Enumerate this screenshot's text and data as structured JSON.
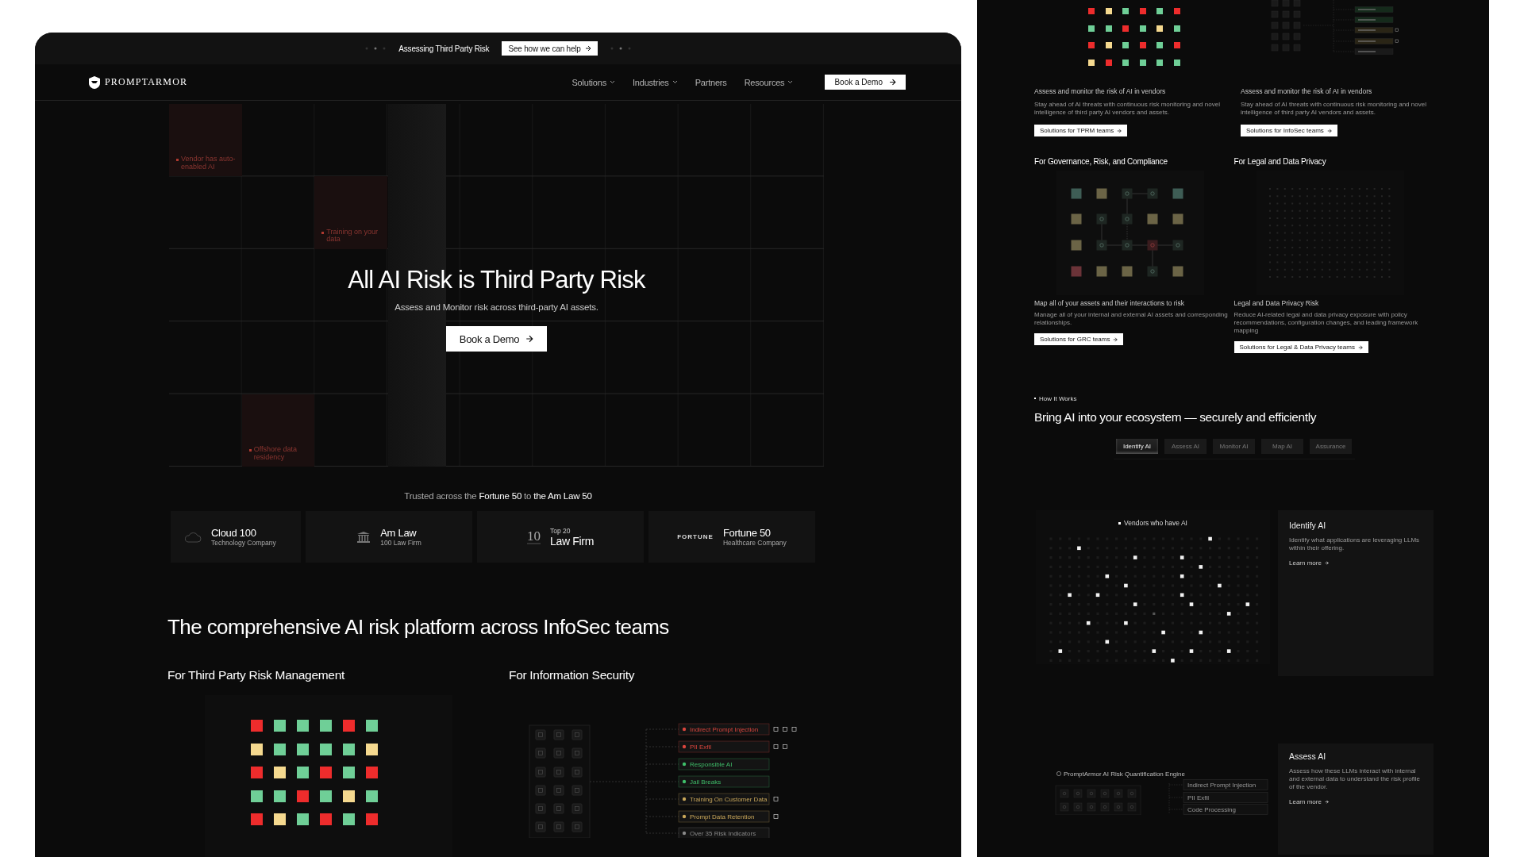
{
  "announcement": {
    "text": "Assessing Third Party Risk",
    "cta": "See how we can help"
  },
  "nav": {
    "logo": "PROMPTARMOR",
    "items": [
      {
        "label": "Solutions",
        "dropdown": true
      },
      {
        "label": "Industries",
        "dropdown": true
      },
      {
        "label": "Partners",
        "dropdown": false
      },
      {
        "label": "Resources",
        "dropdown": true
      }
    ],
    "cta": "Book a Demo"
  },
  "hero": {
    "title": "All AI Risk is Third Party Risk",
    "subtitle": "Assess and Monitor risk across third-party AI assets.",
    "cta": "Book a Demo",
    "risk_tags": [
      "Vendor has auto-enabled AI",
      "Training on your data",
      "Offshore data residency"
    ]
  },
  "trusted": {
    "text": "Trusted across the **Fortune 50** to **the Am Law 50**",
    "logos": [
      {
        "kind": "cloud",
        "title": "Cloud 100",
        "subtitle": "Technology Company"
      },
      {
        "kind": "amlaw",
        "title": "Am Law",
        "subtitle": "100 Law Firm"
      },
      {
        "kind": "ten",
        "mark": "10",
        "eyebrow": "Top 20",
        "title": "Law Firm"
      },
      {
        "kind": "fortune",
        "mark": "FORTUNE",
        "title": "Fortune 50",
        "subtitle": "Healthcare Company"
      }
    ]
  },
  "platform": {
    "title": "The comprehensive AI risk platform across InfoSec teams",
    "columns": [
      {
        "heading": "For Third Party Risk Management",
        "kind": "status_grid"
      },
      {
        "heading": "For Information Security",
        "kind": "risk_flow"
      }
    ],
    "risk_grid": [
      [
        {
          "color": "#ee2c2c"
        },
        {
          "color": "#6fcf97"
        },
        {
          "color": "#6fcf97"
        },
        {
          "color": "#6fcf97"
        },
        {
          "color": "#ee2c2c"
        },
        {
          "color": "#6fcf97"
        }
      ],
      [
        {
          "color": "#f5d98f"
        },
        {
          "color": "#6fcf97"
        },
        {
          "color": "#6fcf97"
        },
        {
          "color": "#6fcf97"
        },
        {
          "color": "#6fcf97"
        },
        {
          "color": "#f5d98f"
        }
      ],
      [
        {
          "color": "#ee2c2c"
        },
        {
          "color": "#f5d98f"
        },
        {
          "color": "#6fcf97"
        },
        {
          "color": "#ee2c2c"
        },
        {
          "color": "#6fcf97"
        },
        {
          "color": "#ee2c2c"
        }
      ],
      [
        {
          "color": "#6fcf97"
        },
        {
          "color": "#6fcf97"
        },
        {
          "color": "#ee2c2c"
        },
        {
          "color": "#6fcf97"
        },
        {
          "color": "#f5d98f"
        },
        {
          "color": "#6fcf97"
        }
      ],
      [
        {
          "color": "#ee2c2c"
        },
        {
          "color": "#f5d98f"
        },
        {
          "color": "#6fcf97"
        },
        {
          "color": "#ee2c2c"
        },
        {
          "color": "#6fcf97"
        },
        {
          "color": "#ee2c2c"
        }
      ]
    ],
    "indicators": [
      {
        "label": "Indirect Prompt Injection",
        "color": "#d9453d",
        "checkboxes": [
          {
            "checked": false
          },
          {
            "checked": false
          },
          {
            "checked": false
          }
        ]
      },
      {
        "label": "PII Exfil",
        "color": "#d9453d",
        "checkboxes": [
          {
            "checked": false
          },
          {
            "checked": false
          }
        ]
      },
      {
        "label": "Responsible AI",
        "color": "#3fbf6a"
      },
      {
        "label": "Jail Breaks",
        "color": "#3fbf6a"
      },
      {
        "label": "Training On Customer Data",
        "color": "#c9a75a",
        "checkboxes": [
          {
            "checked": false
          }
        ]
      },
      {
        "label": "Prompt Data Retention",
        "color": "#c9a75a",
        "checkboxes": [
          {
            "checked": false
          }
        ]
      },
      {
        "label": "Over 35 Risk Indicators",
        "color": "#8a8a8a"
      }
    ]
  },
  "side": {
    "risk_grid": [
      [
        {
          "color": "#ee2c2c"
        },
        {
          "color": "#f5d98f"
        },
        {
          "color": "#6fcf97"
        },
        {
          "color": "#ee2c2c"
        },
        {
          "color": "#6fcf97"
        },
        {
          "color": "#ee2c2c"
        }
      ],
      [
        {
          "color": "#6fcf97"
        },
        {
          "color": "#6fcf97"
        },
        {
          "color": "#ee2c2c"
        },
        {
          "color": "#6fcf97"
        },
        {
          "color": "#f5d98f"
        },
        {
          "color": "#6fcf97"
        }
      ],
      [
        {
          "color": "#ee2c2c"
        },
        {
          "color": "#f5d98f"
        },
        {
          "color": "#6fcf97"
        },
        {
          "color": "#ee2c2c"
        },
        {
          "color": "#6fcf97"
        },
        {
          "color": "#ee2c2c"
        }
      ],
      [
        {
          "color": "#f5d98f"
        },
        {
          "color": "#ee2c2c"
        },
        {
          "color": "#6fcf97"
        },
        {
          "color": "#6fcf97"
        },
        {
          "color": "#6fcf97"
        },
        {
          "color": "#6fcf97"
        }
      ]
    ],
    "intro_columns": [
      {
        "kind": "status_grid",
        "caption": "Assess and monitor the risk of AI in vendors",
        "description": "Stay ahead of AI threats with continuous risk monitoring and novel intelligence of third party AI vendors and assets.",
        "cta": "Solutions for TPRM teams"
      },
      {
        "kind": "risk_flow",
        "caption": "Assess and monitor the risk of AI in vendors",
        "description": "Stay ahead of AI threats with continuous risk monitoring and novel intelligence of third party AI vendors and assets.",
        "cta": "Solutions for InfoSec teams"
      }
    ],
    "solutions": [
      {
        "heading": "For Governance, Risk, and Compliance",
        "kind": "asset_map",
        "caption": "Map all of your assets and their interactions to risk",
        "description": "Manage all of your internal and external AI assets and corresponding relationships.",
        "cta": "Solutions for GRC teams"
      },
      {
        "heading": "For Legal and Data Privacy",
        "kind": "dot_field",
        "caption": "Legal and Data Privacy Risk",
        "description": "Reduce AI-related legal and data privacy exposure with policy recommendations, configuration changes, and leading framework mapping",
        "cta": "Solutions for Legal & Data Privacy teams"
      }
    ],
    "how": {
      "eyebrow": "How It Works",
      "title": "Bring AI into your ecosystem — securely and efficiently",
      "tabs": [
        {
          "label": "Identify AI",
          "selected": true
        },
        {
          "label": "Assess AI",
          "selected": false
        },
        {
          "label": "Monitor AI",
          "selected": false
        },
        {
          "label": "Map AI",
          "selected": false
        },
        {
          "label": "Assurance",
          "selected": false
        }
      ],
      "vendors_label": "Vendors who have AI",
      "engine_label": "PromptArmor AI Risk Quantification Engine",
      "engine_indicators": [
        "Indirect Prompt Injection",
        "PII Exfil",
        "Code Processing"
      ],
      "cards": [
        {
          "title": "Identify AI",
          "description": "Identify what applications are leveraging LLMs within their offering.",
          "link": "Learn more"
        },
        {
          "title": "Assess AI",
          "description": "Assess how these LLMs interact with internal and external data to understand the risk profile of the vendor.",
          "link": "Learn more"
        }
      ]
    }
  }
}
